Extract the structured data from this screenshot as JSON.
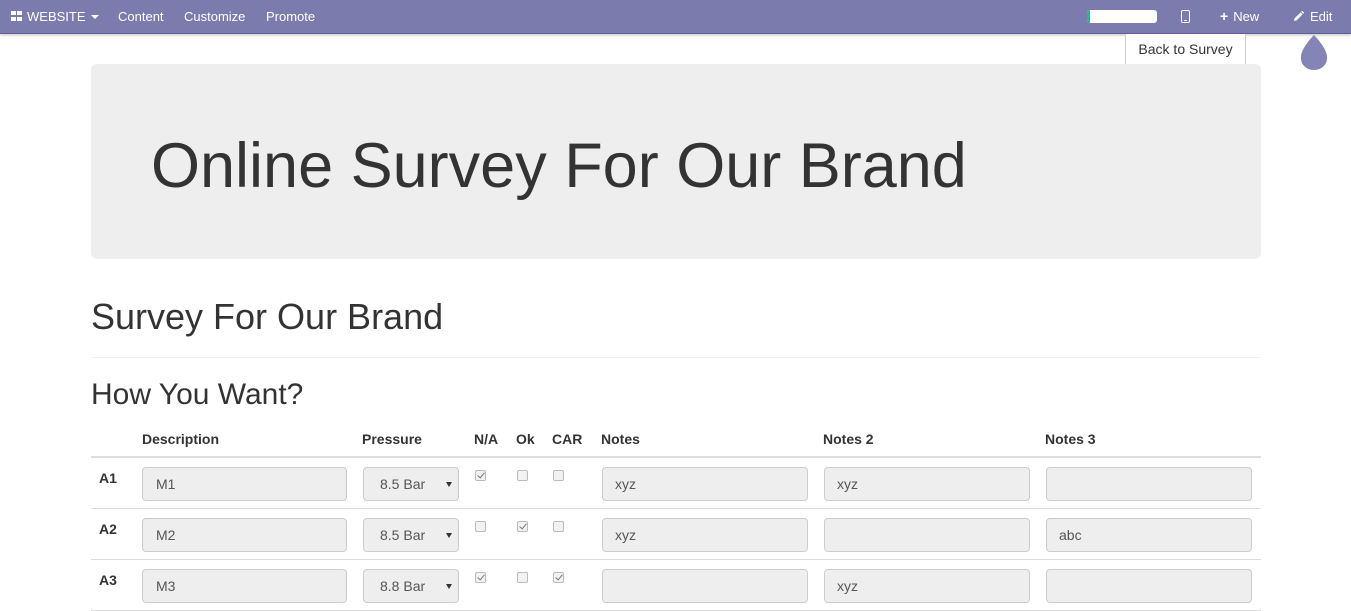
{
  "topbar": {
    "website_label": "WEBSITE",
    "menu": [
      "Content",
      "Customize",
      "Promote"
    ],
    "progress_fraction": 0.04,
    "new_label": "New",
    "edit_label": "Edit",
    "bar_color": "#7c7bad"
  },
  "back_to_survey": "Back to Survey",
  "jumbotron_title": "Online Survey For Our Brand",
  "survey_title": "Survey For Our Brand",
  "page_title": "How You Want?",
  "matrix": {
    "headers": {
      "description": "Description",
      "pressure": "Pressure",
      "na": "N/A",
      "ok": "Ok",
      "car": "CAR",
      "notes": "Notes",
      "notes2": "Notes 2",
      "notes3": "Notes 3"
    },
    "rows": [
      {
        "label": "A1",
        "description": "M1",
        "pressure": "8.5 Bar",
        "na": true,
        "ok": false,
        "car": false,
        "notes": "xyz",
        "notes2": "xyz",
        "notes3": ""
      },
      {
        "label": "A2",
        "description": "M2",
        "pressure": "8.5 Bar",
        "na": false,
        "ok": true,
        "car": false,
        "notes": "xyz",
        "notes2": "",
        "notes3": "abc"
      },
      {
        "label": "A3",
        "description": "M3",
        "pressure": "8.8 Bar",
        "na": true,
        "ok": false,
        "car": true,
        "notes": "",
        "notes2": "xyz",
        "notes3": ""
      }
    ]
  }
}
